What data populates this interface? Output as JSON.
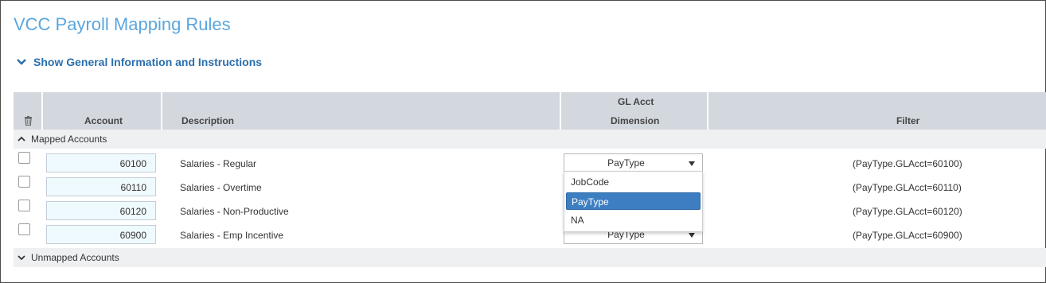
{
  "page": {
    "title": "VCC Payroll Mapping Rules",
    "info_toggle_label": "Show General Information and Instructions"
  },
  "grid": {
    "columns": {
      "delete": "trash-icon",
      "account": "Account",
      "description": "Description",
      "dimension_line1": "GL Acct",
      "dimension_line2": "Dimension",
      "filter": "Filter"
    },
    "groups": {
      "mapped": "Mapped Accounts",
      "unmapped": "Unmapped Accounts"
    },
    "rows": [
      {
        "account": "60100",
        "description": "Salaries - Regular",
        "dimension": "PayType",
        "filter": "(PayType.GLAcct=60100)"
      },
      {
        "account": "60110",
        "description": "Salaries - Overtime",
        "dimension": "PayType",
        "filter": "(PayType.GLAcct=60110)"
      },
      {
        "account": "60120",
        "description": "Salaries - Non-Productive",
        "dimension": "PayType",
        "filter": "(PayType.GLAcct=60120)"
      },
      {
        "account": "60900",
        "description": "Salaries - Emp Incentive",
        "dimension": "PayType",
        "filter": "(PayType.GLAcct=60900)"
      }
    ]
  },
  "dropdown": {
    "options": [
      "JobCode",
      "PayType",
      "NA"
    ],
    "selected": "PayType"
  },
  "colors": {
    "title": "#5aa6dd",
    "link": "#2a6fae",
    "header_bg": "#d3d8de",
    "input_bg": "#effaff",
    "selected_option": "#3d7ec2"
  }
}
